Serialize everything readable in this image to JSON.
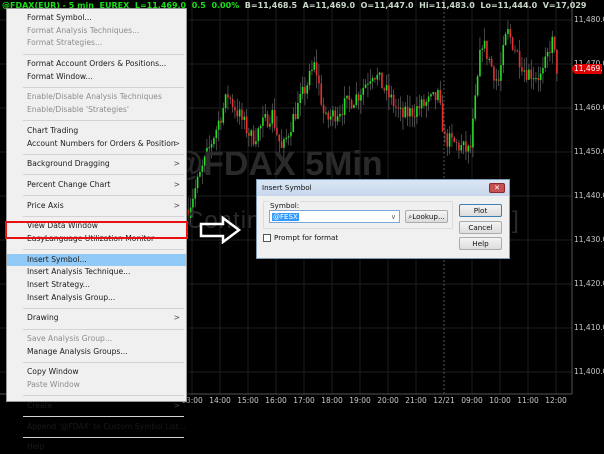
{
  "status_bar": {
    "symbol": "@FDAX(EUR) - 5 min",
    "exchange": "EUREX",
    "last": "L=11,469.0",
    "change": "0.5",
    "change_pct": "0.00%",
    "bid": "B=11,468.5",
    "ask": "A=11,469.0",
    "open": "O=11,447.0",
    "high": "Hi=11,483.0",
    "low": "Lo=11,444.0",
    "volume": "V=17,029"
  },
  "watermark": {
    "line1": "@FDAX 5Min",
    "line2": "Continuous Contract [Mar17]"
  },
  "price_axis": [
    "11,480.0",
    "11,470.0",
    "11,460.0",
    "11,450.0",
    "11,440.0",
    "11,430.0",
    "11,420.0",
    "11,410.0",
    "11,400.0"
  ],
  "last_price_tag": "11,469.0",
  "time_axis": [
    "13:00",
    "14:00",
    "15:00",
    "16:00",
    "17:00",
    "18:00",
    "19:00",
    "20:00",
    "21:00",
    "12/21",
    "09:00",
    "10:00",
    "11:00",
    "12:00"
  ],
  "colors": {
    "up": "#22e022",
    "down": "#e83030",
    "grid": "#1e1e1e",
    "highlight": "#e81010"
  },
  "price_path": [
    {
      "time": "12:52",
      "day": 1,
      "price": 11437
    },
    {
      "time": "14:17",
      "day": 1,
      "price": 11463
    },
    {
      "time": "15:09",
      "day": 1,
      "price": 11453
    },
    {
      "time": "15:51",
      "day": 1,
      "price": 11459
    },
    {
      "time": "16:13",
      "day": 1,
      "price": 11450
    },
    {
      "time": "16:34",
      "day": 1,
      "price": 11457
    },
    {
      "time": "17:24",
      "day": 1,
      "price": 11470
    },
    {
      "time": "17:45",
      "day": 1,
      "price": 11457
    },
    {
      "time": "18:56",
      "day": 1,
      "price": 11463
    },
    {
      "time": "19:28",
      "day": 1,
      "price": 11468.5
    },
    {
      "time": "19:54",
      "day": 1,
      "price": 11464
    },
    {
      "time": "20:30",
      "day": 1,
      "price": 11458
    },
    {
      "time": "21:47",
      "day": 1,
      "price": 11462.5
    },
    {
      "time": "08:02",
      "day": 2,
      "price": 11453
    },
    {
      "time": "08:56",
      "day": 2,
      "price": 11450
    },
    {
      "time": "09:21",
      "day": 2,
      "price": 11475.5
    },
    {
      "time": "09:56",
      "day": 2,
      "price": 11465.5
    },
    {
      "time": "10:15",
      "day": 2,
      "price": 11477.5
    },
    {
      "time": "10:54",
      "day": 2,
      "price": 11468.5
    },
    {
      "time": "11:30",
      "day": 2,
      "price": 11467
    },
    {
      "time": "11:51",
      "day": 2,
      "price": 11475.5
    },
    {
      "time": "12:02",
      "day": 2,
      "price": 11469
    }
  ],
  "context_menu": [
    {
      "label": "Format Symbol..."
    },
    {
      "label": "Format Analysis Techniques...",
      "disabled": true
    },
    {
      "label": "Format Strategies...",
      "disabled": true
    },
    {
      "sep": true
    },
    {
      "label": "Format Account Orders & Positions..."
    },
    {
      "label": "Format Window..."
    },
    {
      "sep": true
    },
    {
      "label": "Enable/Disable Analysis Techniques",
      "disabled": true
    },
    {
      "label": "Enable/Disable 'Strategies'",
      "disabled": true
    },
    {
      "sep": true
    },
    {
      "label": "Chart Trading"
    },
    {
      "label": "Account Numbers for Orders & Position",
      "submenu": true
    },
    {
      "sep": true
    },
    {
      "label": "Background Dragging",
      "submenu": true
    },
    {
      "sep": true
    },
    {
      "label": "Percent Change Chart",
      "submenu": true
    },
    {
      "sep": true
    },
    {
      "label": "Price Axis",
      "submenu": true
    },
    {
      "sep": true
    },
    {
      "label": "View Data Window"
    },
    {
      "label": "EasyLanguage Utilization Monitor"
    },
    {
      "sep": true
    },
    {
      "label": "Insert Symbol...",
      "highlighted": true
    },
    {
      "label": "Insert Analysis Technique..."
    },
    {
      "label": "Insert Strategy..."
    },
    {
      "label": "Insert Analysis Group..."
    },
    {
      "sep": true
    },
    {
      "label": "Drawing",
      "submenu": true
    },
    {
      "sep": true
    },
    {
      "label": "Save Analysis Group...",
      "disabled": true
    },
    {
      "label": "Manage Analysis Groups..."
    },
    {
      "sep": true
    },
    {
      "label": "Copy Window"
    },
    {
      "label": "Paste Window",
      "disabled": true
    },
    {
      "sep": true
    },
    {
      "label": "Create",
      "submenu": true
    },
    {
      "sep": true
    },
    {
      "label": "Append '@FDAX' to Custom Symbol List..."
    },
    {
      "sep": true
    },
    {
      "label": "Help"
    }
  ],
  "submenu_arrow": ">",
  "dialog": {
    "title": "Insert Symbol",
    "close": "✕",
    "symbol_label": "Symbol:",
    "symbol_value": "@FESX",
    "lookup": "Lookup...",
    "prompt_label": "Prompt for format",
    "prompt_checked": false,
    "plot": "Plot",
    "cancel": "Cancel",
    "help": "Help"
  }
}
